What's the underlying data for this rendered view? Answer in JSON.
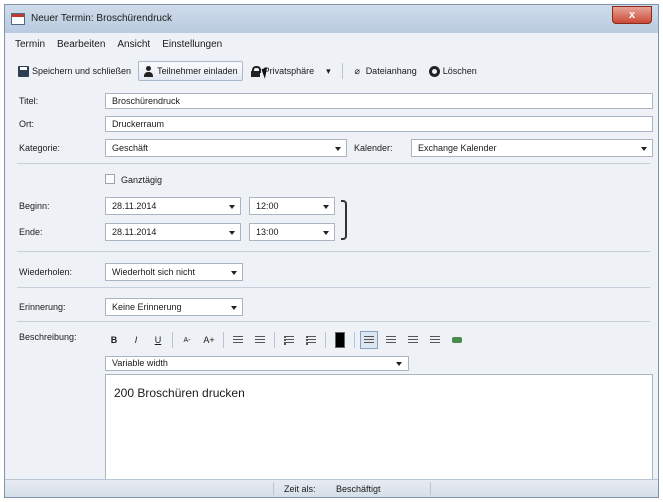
{
  "window": {
    "title": "Neuer Termin: Broschürendruck",
    "close_label": "x"
  },
  "menu": [
    "Termin",
    "Bearbeiten",
    "Ansicht",
    "Einstellungen"
  ],
  "toolbar": {
    "save": "Speichern und schließen",
    "invite": "Teilnehmer einladen",
    "privacy": "Privatsphäre",
    "attachment": "Dateianhang",
    "delete": "Löschen"
  },
  "form": {
    "title_label": "Titel:",
    "title_value": "Broschürendruck",
    "location_label": "Ort:",
    "location_value": "Druckerraum",
    "category_label": "Kategorie:",
    "category_value": "Geschäft",
    "calendar_label": "Kalender:",
    "calendar_value": "Exchange Kalender",
    "allday_label": "Ganztägig",
    "start_label": "Beginn:",
    "start_date": "28.11.2014",
    "start_time": "12:00",
    "end_label": "Ende:",
    "end_date": "28.11.2014",
    "end_time": "13:00",
    "repeat_label": "Wiederholen:",
    "repeat_value": "Wiederholt sich nicht",
    "reminder_label": "Erinnerung:",
    "reminder_value": "Keine Erinnerung",
    "description_label": "Beschreibung:",
    "font_value": "Variable width",
    "description_text": "200 Broschüren drucken"
  },
  "format": {
    "bold": "B",
    "italic": "I",
    "underline": "U",
    "smaller": "A-",
    "larger": "A+"
  },
  "status": {
    "label": "Zeit als:",
    "value": "Beschäftigt"
  }
}
